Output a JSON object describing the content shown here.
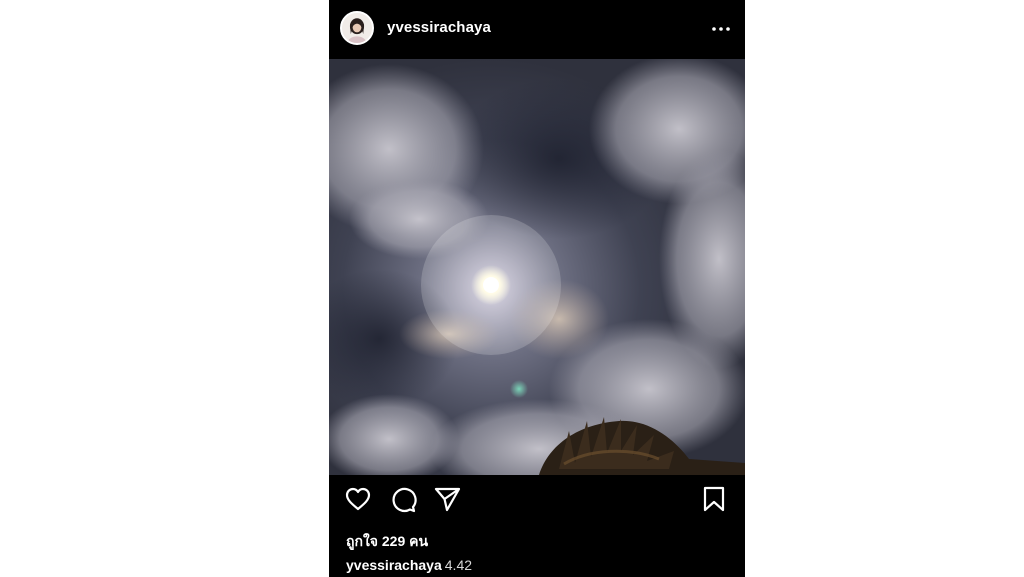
{
  "post": {
    "username": "yvessirachaya",
    "likes_text": "ถูกใจ 229 คน",
    "caption": {
      "username": "yvessirachaya",
      "text": "4.42"
    }
  },
  "icons": {
    "avatar": "profile-avatar",
    "more": "more-horizontal-icon",
    "like": "heart-icon",
    "comment": "comment-icon",
    "share": "send-icon",
    "save": "bookmark-icon"
  },
  "colors": {
    "background": "#000000",
    "text": "#ffffff",
    "page": "#ffffff"
  }
}
